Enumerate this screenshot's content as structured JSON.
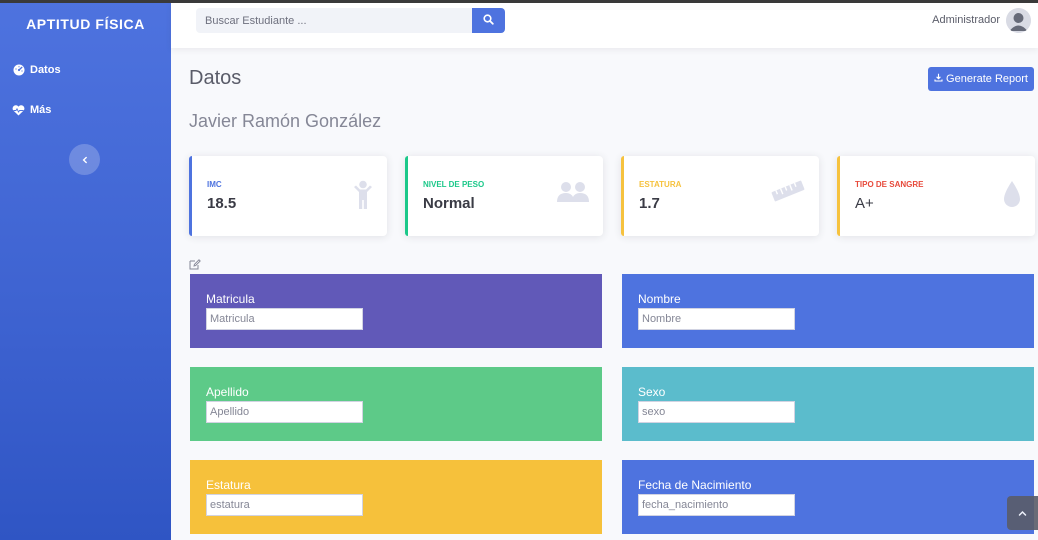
{
  "app": {
    "brand": "APTITUD FÍSICA"
  },
  "sidebar": {
    "items": [
      {
        "label": "Datos",
        "icon": "tachometer-icon"
      },
      {
        "label": "Más",
        "icon": "heartbeat-icon"
      }
    ],
    "toggle_icon": "chevron-left-icon"
  },
  "topbar": {
    "search_placeholder": "Buscar Estudiante ...",
    "user_name": "Administrador"
  },
  "main": {
    "title": "Datos",
    "report_button": "Generate Report",
    "student_name": "Javier Ramón González"
  },
  "cards": [
    {
      "label": "IMC",
      "value": "18.5",
      "color": "#4e73df",
      "icon": "child-icon"
    },
    {
      "label": "Nivel de Peso",
      "value": "Normal",
      "color": "#1cc88a",
      "icon": "users-icon"
    },
    {
      "label": "Estatura",
      "value": "1.7",
      "color": "#f6c23e",
      "icon": "ruler-icon"
    },
    {
      "label": "Tipo de Sangre",
      "value": "A+",
      "color": "#e74a3b",
      "icon": "tint-icon"
    }
  ],
  "fields": [
    {
      "label": "Matricula",
      "placeholder": "Matricula",
      "color": "#6159b8"
    },
    {
      "label": "Nombre",
      "placeholder": "Nombre",
      "color": "#4e73df"
    },
    {
      "label": "Apellido",
      "placeholder": "Apellido",
      "color": "#5dca88"
    },
    {
      "label": "Sexo",
      "placeholder": "sexo",
      "color": "#5bbccc"
    },
    {
      "label": "Estatura",
      "placeholder": "estatura",
      "color": "#f6c13b"
    },
    {
      "label": "Fecha de Nacimiento",
      "placeholder": "fecha_nacimiento",
      "color": "#4e73df"
    }
  ]
}
